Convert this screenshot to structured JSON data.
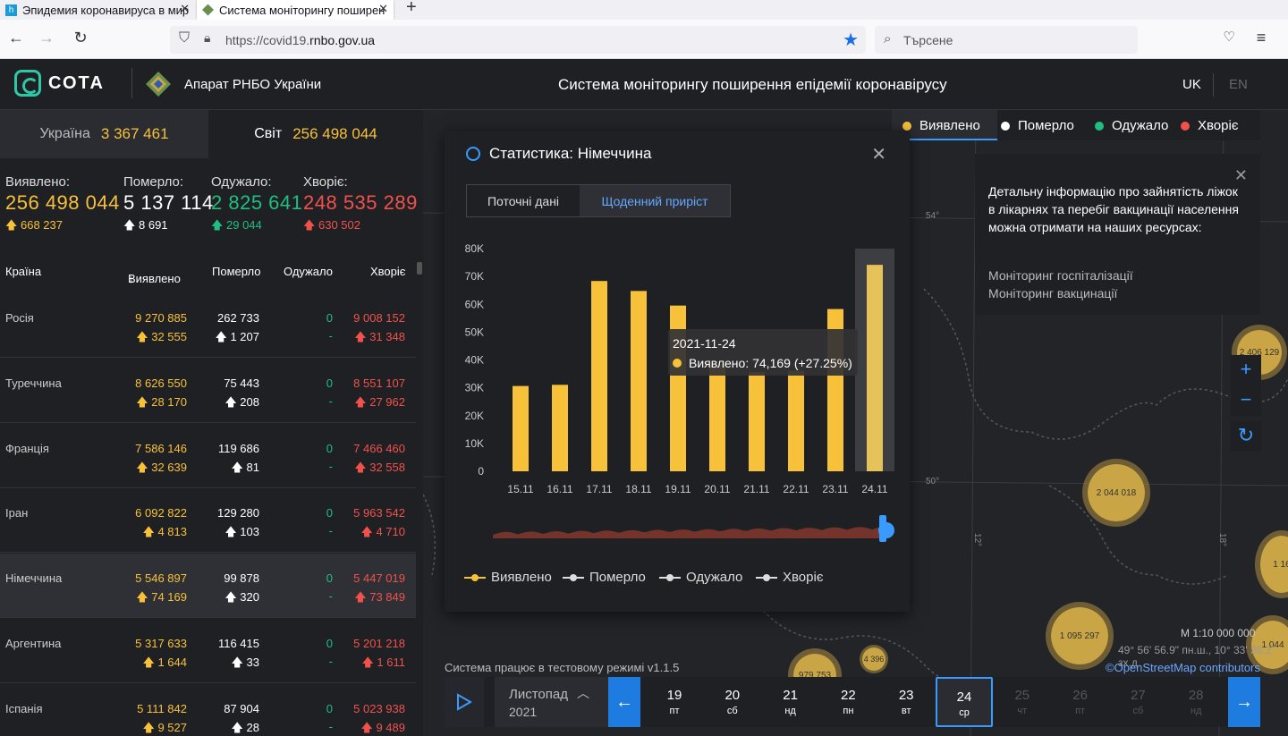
{
  "browser": {
    "tabs": [
      {
        "label": "Эпидемия коронавируса в мир"
      },
      {
        "label": "Система моніторингу поширен"
      }
    ],
    "url_prefix": "https://covid19.",
    "url_domain": "rnbo.gov.ua",
    "search_placeholder": "Търсене"
  },
  "header": {
    "logo_text": "СОТА",
    "org": "Апарат РНБО України",
    "system_title": "Система моніторингу поширення епідемії коронавірусу",
    "lang_uk": "UK",
    "lang_en": "EN"
  },
  "region_tabs": {
    "ukraine_label": "Україна",
    "ukraine_value": "3 367 461",
    "world_label": "Світ",
    "world_value": "256 498 044"
  },
  "totals": {
    "confirmed": {
      "label": "Виявлено:",
      "value": "256 498 044",
      "delta": "668 237"
    },
    "deaths": {
      "label": "Померло:",
      "value": "5 137 114",
      "delta": "8 691"
    },
    "recovered": {
      "label": "Одужало:",
      "value": "2 825 641",
      "delta": "29 044"
    },
    "sick": {
      "label": "Хворіє:",
      "value": "248 535 289",
      "delta": "630 502"
    }
  },
  "table": {
    "headers": {
      "country": "Країна",
      "confirmed": "Виявлено",
      "deaths": "Померло",
      "recovered": "Одужало",
      "sick": "Хворіє"
    },
    "rows": [
      {
        "country": "Росія",
        "confirmed": "9 270 885",
        "confirmed_d": "32 555",
        "deaths": "262 733",
        "deaths_d": "1 207",
        "recovered": "0",
        "recovered_d": "-",
        "sick": "9 008 152",
        "sick_d": "31 348"
      },
      {
        "country": "Туреччина",
        "confirmed": "8 626 550",
        "confirmed_d": "28 170",
        "deaths": "75 443",
        "deaths_d": "208",
        "recovered": "0",
        "recovered_d": "-",
        "sick": "8 551 107",
        "sick_d": "27 962"
      },
      {
        "country": "Франція",
        "confirmed": "7 586 146",
        "confirmed_d": "32 639",
        "deaths": "119 686",
        "deaths_d": "81",
        "recovered": "0",
        "recovered_d": "-",
        "sick": "7 466 460",
        "sick_d": "32 558"
      },
      {
        "country": "Іран",
        "confirmed": "6 092 822",
        "confirmed_d": "4 813",
        "deaths": "129 280",
        "deaths_d": "103",
        "recovered": "0",
        "recovered_d": "-",
        "sick": "5 963 542",
        "sick_d": "4 710"
      },
      {
        "country": "Німеччина",
        "confirmed": "5 546 897",
        "confirmed_d": "74 169",
        "deaths": "99 878",
        "deaths_d": "320",
        "recovered": "0",
        "recovered_d": "-",
        "sick": "5 447 019",
        "sick_d": "73 849"
      },
      {
        "country": "Аргентина",
        "confirmed": "5 317 633",
        "confirmed_d": "1 644",
        "deaths": "116 415",
        "deaths_d": "33",
        "recovered": "0",
        "recovered_d": "-",
        "sick": "5 201 218",
        "sick_d": "1 611"
      },
      {
        "country": "Іспанія",
        "confirmed": "5 111 842",
        "confirmed_d": "9 527",
        "deaths": "87 904",
        "deaths_d": "28",
        "recovered": "0",
        "recovered_d": "-",
        "sick": "5 023 938",
        "sick_d": "9 489"
      }
    ]
  },
  "map_legend": {
    "confirmed": "Виявлено",
    "deaths": "Померло",
    "recovered": "Одужало",
    "sick": "Хворіє"
  },
  "info_box": {
    "text": "Детальну інформацію про зайнятість ліжок в лікарнях та перебіг вакцинації населення можна отримати на наших ресурсах:",
    "link1": "Моніторинг госпіталізації",
    "link2": "Моніторинг вакцинації"
  },
  "map": {
    "clusters": [
      "2 044 018",
      "1 095 297",
      "4 396",
      "2 406 129",
      "1 16",
      "1 044",
      "979 753"
    ],
    "lat_labels": [
      "54°",
      "50°"
    ],
    "lon_labels": [
      "12°",
      "18°"
    ],
    "scale": "M 1:10 000 000",
    "coords": "49° 56' 56.9\" пн.ш., 10° 33' 36.2\" зх.д.",
    "osm": "©OpenStreetMap contributors",
    "test_mode": "Система працює в тестовому режимі v1.1.5"
  },
  "modal": {
    "title": "Статистика: Німеччина",
    "tab_current": "Поточні дані",
    "tab_daily": "Щоденний приріст",
    "tooltip_date": "2021-11-24",
    "tooltip_text": "Виявлено: 74,169 (+27.25%)",
    "legend": [
      "Виявлено",
      "Померло",
      "Одужало",
      "Хворіє"
    ]
  },
  "chart_data": {
    "type": "bar",
    "categories": [
      "15.11",
      "16.11",
      "17.11",
      "18.11",
      "19.11",
      "20.11",
      "21.11",
      "22.11",
      "23.11",
      "24.11"
    ],
    "series": [
      {
        "name": "Виявлено",
        "values": [
          30643,
          31067,
          68366,
          64785,
          59542,
          38400,
          35600,
          36100,
          58292,
          74169
        ]
      }
    ],
    "yticks": [
      "0",
      "10K",
      "20K",
      "30K",
      "40K",
      "50K",
      "60K",
      "70K",
      "80K"
    ],
    "ylim": [
      0,
      80000
    ],
    "bar_color": "#f7c13a",
    "highlight_index": 9
  },
  "timeline": {
    "month": "Листопад",
    "year": "2021",
    "days": [
      {
        "d": "19",
        "w": "пт"
      },
      {
        "d": "20",
        "w": "сб"
      },
      {
        "d": "21",
        "w": "нд"
      },
      {
        "d": "22",
        "w": "пн"
      },
      {
        "d": "23",
        "w": "вт"
      },
      {
        "d": "24",
        "w": "ср"
      },
      {
        "d": "25",
        "w": "чт"
      },
      {
        "d": "26",
        "w": "пт"
      },
      {
        "d": "27",
        "w": "сб"
      },
      {
        "d": "28",
        "w": "нд"
      }
    ],
    "current_index": 5
  },
  "colors": {
    "confirmed": "#f7c13a",
    "deaths": "#ffffff",
    "recovered": "#1fbf7f",
    "sick": "#f0524b",
    "accent": "#3a9bff"
  }
}
